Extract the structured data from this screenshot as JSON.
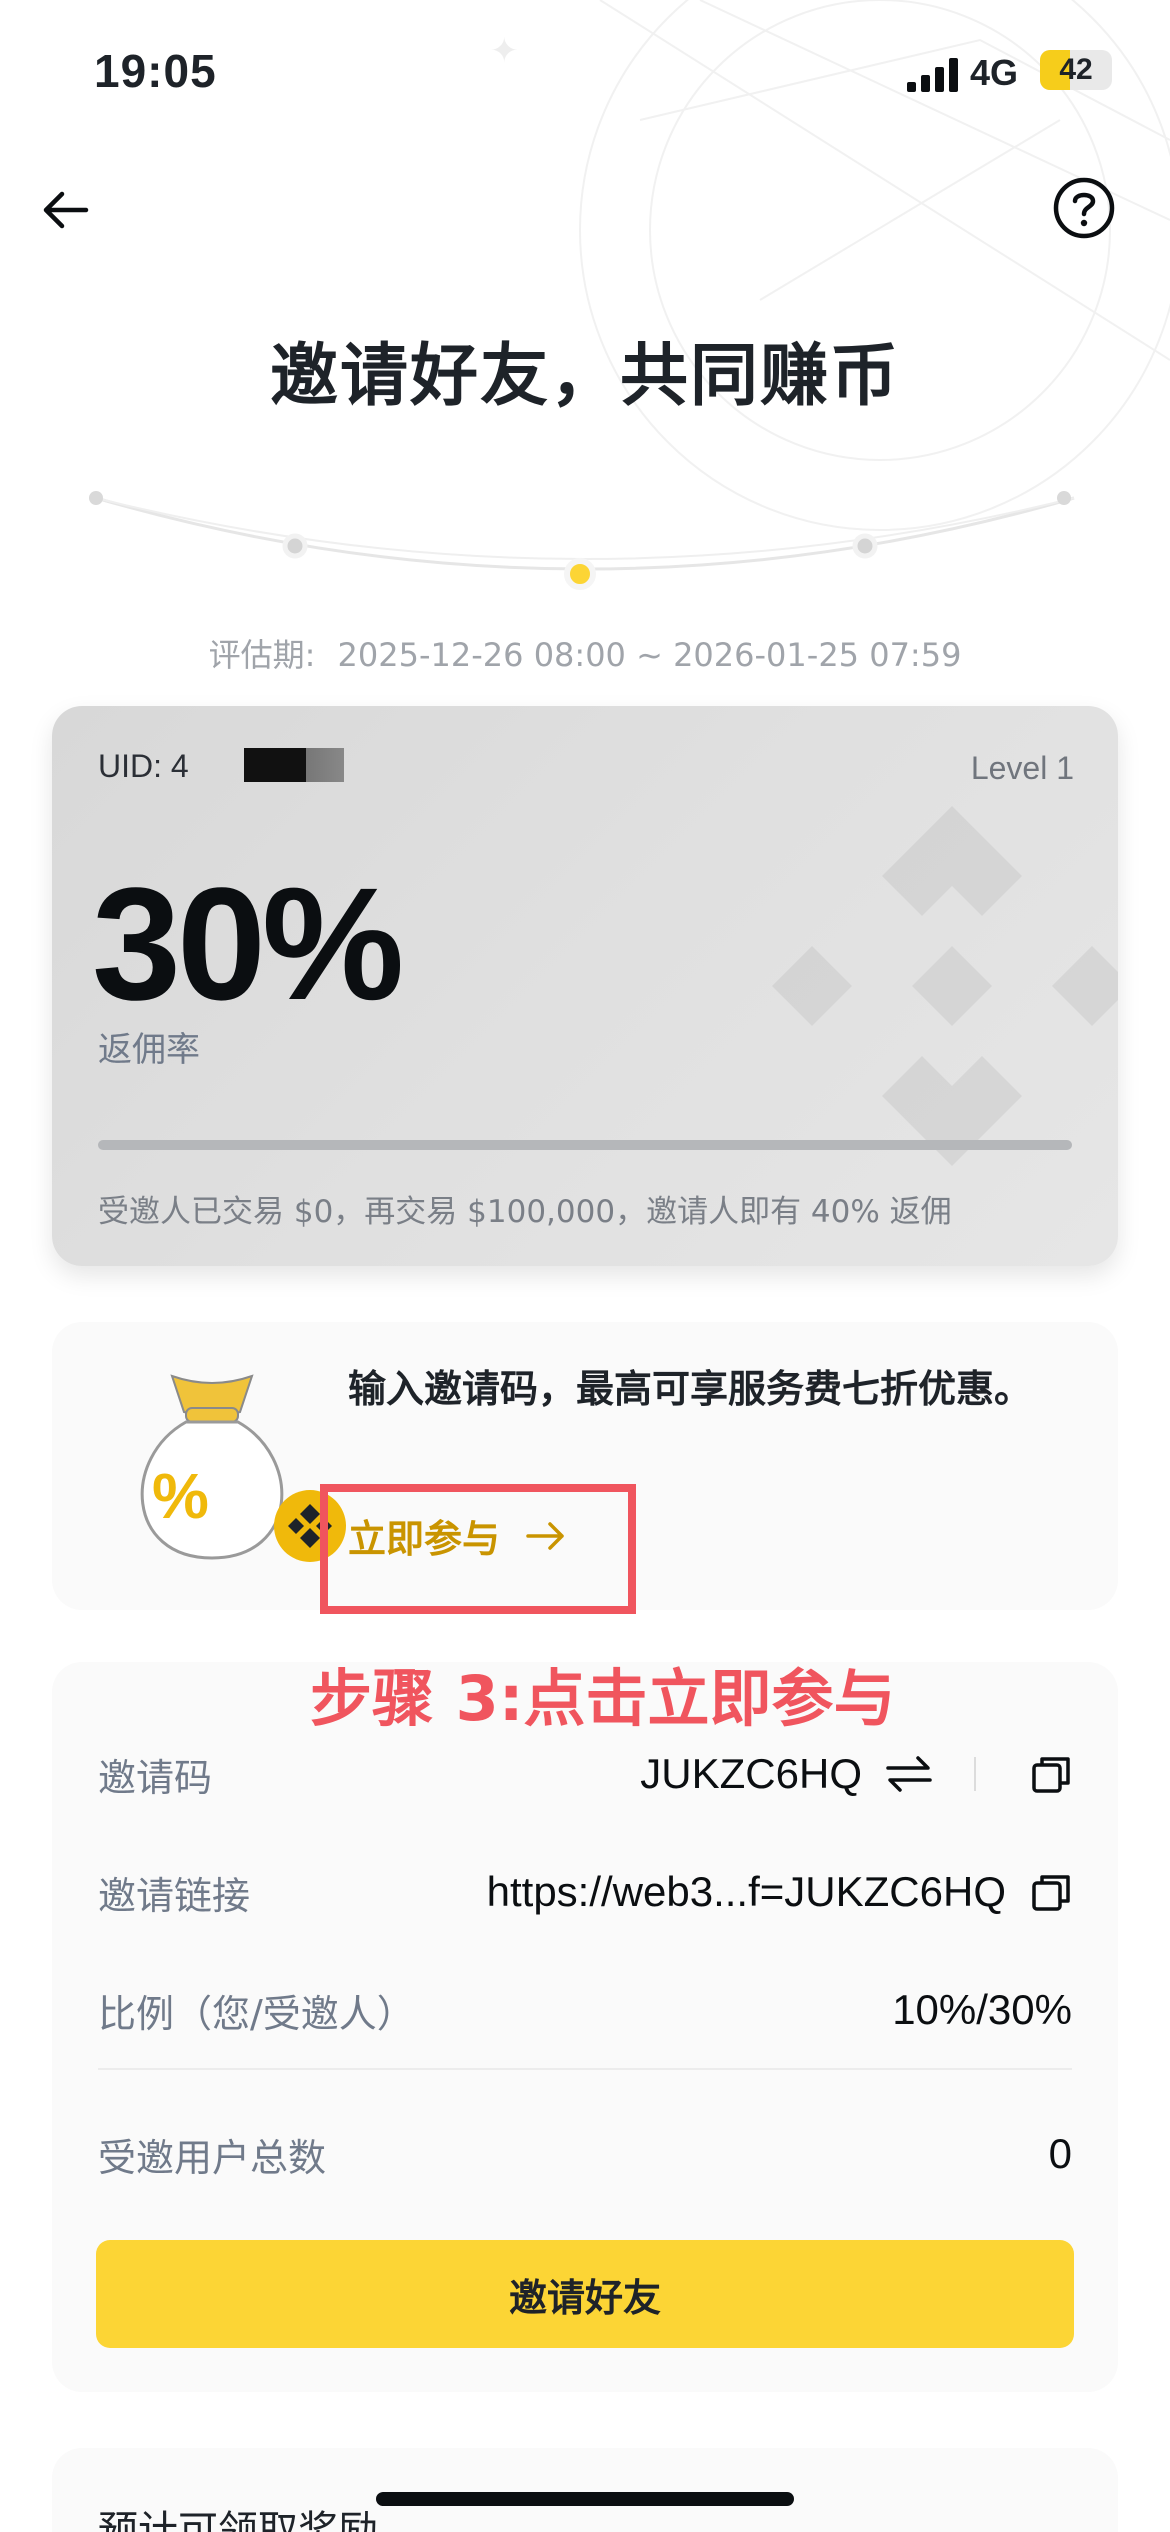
{
  "status_bar": {
    "time": "19:05",
    "network": "4G",
    "battery": "42",
    "battery_level": 0.42
  },
  "header": {
    "title": "邀请好友，共同赚币"
  },
  "eval_period": {
    "label": "评估期:",
    "range": "2025-12-26 08:00 ~ 2026-01-25 07:59"
  },
  "rate_card": {
    "uid_label": "UID: 4",
    "level": "Level 1",
    "rate": "30%",
    "rate_label": "返佣率",
    "progress": 0,
    "note": "受邀人已交易 $0，再交易 $100,000，邀请人即有 40% 返佣"
  },
  "promo": {
    "text": "输入邀请码，最高可享服务费七折优惠。",
    "link": "立即参与",
    "badge": "%"
  },
  "annotation": {
    "text": "步骤 3:点击立即参与",
    "color": "#f0555e"
  },
  "invite_info": {
    "code_label": "邀请码",
    "code": "JUKZC6HQ",
    "link_label": "邀请链接",
    "link": "https://web3...f=JUKZC6HQ",
    "ratio_label": "比例（您/受邀人）",
    "ratio": "10%/30%",
    "total_label": "受邀用户总数",
    "total": "0",
    "button": "邀请好友"
  },
  "reward": {
    "title": "预计可领取奖励"
  },
  "colors": {
    "brand_yellow": "#fcd535",
    "accent_gold": "#c99400"
  }
}
